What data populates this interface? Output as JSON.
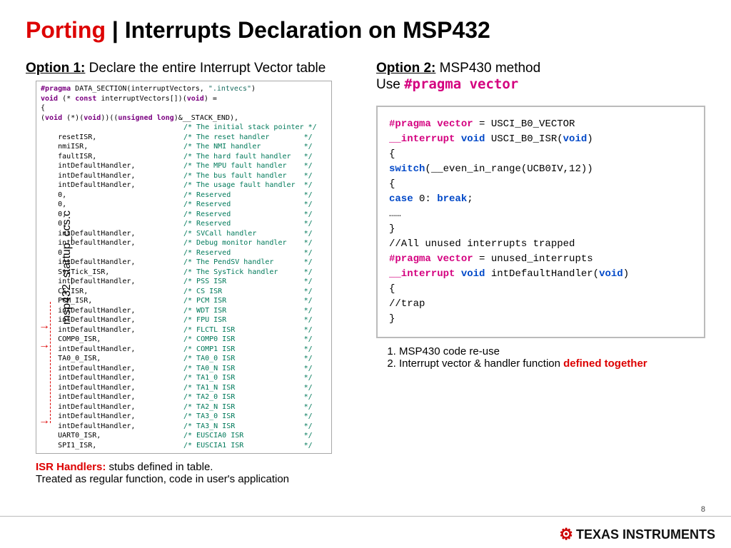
{
  "title_red": "Porting",
  "title_sep": " | ",
  "title_rest": "Interrupts Declaration on MSP432",
  "option1": {
    "label": "Option 1:",
    "desc": " Declare the entire Interrupt Vector table",
    "filename": "msp432_startup_ccs.c"
  },
  "option2": {
    "label": "Option 2:",
    "desc": " MSP430 method",
    "desc2": "Use ",
    "pragma": "#pragma vector"
  },
  "code1": {
    "l1a": "#pragma",
    "l1b": " DATA_SECTION(interruptVectors, ",
    "l1c": "\".intvecs\"",
    "l1d": ")",
    "l2a": "void",
    "l2b": " (* ",
    "l2c": "const",
    "l2d": " interruptVectors[])(",
    "l2e": "void",
    "l2f": ") =",
    "l3": "{",
    "l4a": "    (",
    "l4b": "void",
    "l4c": " (*)(",
    "l4d": "void",
    "l4e": "))((",
    "l4f": "unsigned long",
    "l4g": ")&__STACK_END),",
    "rows": [
      {
        "l": "",
        "c": "/* The initial stack pointer */"
      },
      {
        "l": "    resetISR,",
        "c": "/* The reset handler        */"
      },
      {
        "l": "    nmiISR,",
        "c": "/* The NMI handler          */"
      },
      {
        "l": "    faultISR,",
        "c": "/* The hard fault handler   */"
      },
      {
        "l": "    intDefaultHandler,",
        "c": "/* The MPU fault handler    */"
      },
      {
        "l": "    intDefaultHandler,",
        "c": "/* The bus fault handler    */"
      },
      {
        "l": "    intDefaultHandler,",
        "c": "/* The usage fault handler  */"
      },
      {
        "l": "    0,",
        "c": "/* Reserved                 */"
      },
      {
        "l": "    0,",
        "c": "/* Reserved                 */"
      },
      {
        "l": "    0,",
        "c": "/* Reserved                 */"
      },
      {
        "l": "    0,",
        "c": "/* Reserved                 */"
      },
      {
        "l": "    intDefaultHandler,",
        "c": "/* SVCall handler           */"
      },
      {
        "l": "    intDefaultHandler,",
        "c": "/* Debug monitor handler    */"
      },
      {
        "l": "    0,",
        "c": "/* Reserved                 */"
      },
      {
        "l": "    intDefaultHandler,",
        "c": "/* The PendSV handler       */"
      },
      {
        "l": "    SysTick_ISR,",
        "c": "/* The SysTick handler      */"
      },
      {
        "l": "    intDefaultHandler,",
        "c": "/* PSS ISR                  */"
      },
      {
        "l": "    CS_ISR,",
        "c": "/* CS ISR                   */"
      },
      {
        "l": "    PCM_ISR,",
        "c": "/* PCM ISR                  */"
      },
      {
        "l": "    intDefaultHandler,",
        "c": "/* WDT ISR                  */"
      },
      {
        "l": "    intDefaultHandler,",
        "c": "/* FPU ISR                  */"
      },
      {
        "l": "    intDefaultHandler,",
        "c": "/* FLCTL ISR                */"
      },
      {
        "l": "    COMP0_ISR,",
        "c": "/* COMP0 ISR                */"
      },
      {
        "l": "    intDefaultHandler,",
        "c": "/* COMP1 ISR                */"
      },
      {
        "l": "    TA0_0_ISR,",
        "c": "/* TA0_0 ISR                */"
      },
      {
        "l": "    intDefaultHandler,",
        "c": "/* TA0_N ISR                */"
      },
      {
        "l": "    intDefaultHandler,",
        "c": "/* TA1_0 ISR                */"
      },
      {
        "l": "    intDefaultHandler,",
        "c": "/* TA1_N ISR                */"
      },
      {
        "l": "    intDefaultHandler,",
        "c": "/* TA2_0 ISR                */"
      },
      {
        "l": "    intDefaultHandler,",
        "c": "/* TA2_N ISR                */"
      },
      {
        "l": "    intDefaultHandler,",
        "c": "/* TA3_0 ISR                */"
      },
      {
        "l": "    intDefaultHandler,",
        "c": "/* TA3_N ISR                */"
      },
      {
        "l": "    UART0_ISR,",
        "c": "/* EUSCIA0 ISR              */"
      },
      {
        "l": "    SPI1_ISR,",
        "c": "/* EUSCIA1 ISR              */"
      }
    ]
  },
  "code2": {
    "l1": "#pragma vector",
    "l1b": " = USCI_B0_VECTOR",
    "l2a": "__interrupt",
    "l2b": " void",
    "l2c": " USCI_B0_ISR(",
    "l2d": "void",
    "l2e": ")",
    "l3": "{",
    "l4a": "   ",
    "l4b": "switch",
    "l4c": "(__even_in_range(UCB0IV,12))",
    "l5": "   {",
    "l6a": "   ",
    "l6b": "case",
    "l6c": "  0: ",
    "l6d": "break",
    "l6e": ";",
    "l7": "   ……",
    "l8": "}",
    "blank": " ",
    "l9": "//All unused interrupts trapped",
    "l10": "#pragma vector",
    "l10b": " = unused_interrupts",
    "l11a": "__interrupt",
    "l11b": " void",
    "l11c": " intDefaultHandler(",
    "l11d": "void",
    "l11e": ")",
    "l12": "{",
    "l13": "    //trap",
    "l14": "}"
  },
  "bottom_left": {
    "red": "ISR Handlers:",
    "rest": " stubs defined in table.",
    "line2": "Treated as regular function, code in user's application"
  },
  "bottom_right": {
    "item1": "MSP430 code re-use",
    "item2a": "Interrupt vector & handler function ",
    "item2b": "defined together"
  },
  "page_num": "8",
  "logo": "TEXAS INSTRUMENTS"
}
